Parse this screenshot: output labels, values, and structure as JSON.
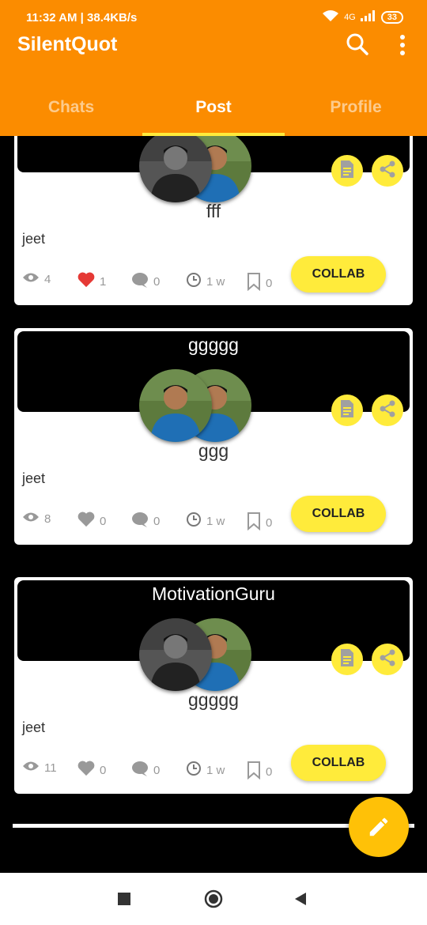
{
  "status_bar": {
    "time_speed": "11:32 AM | 38.4KB/s",
    "network": "4G",
    "battery": "33"
  },
  "app": {
    "title": "SilentQuot"
  },
  "tabs": [
    {
      "label": "Chats",
      "active": false
    },
    {
      "label": "Post",
      "active": true
    },
    {
      "label": "Profile",
      "active": false
    }
  ],
  "posts": [
    {
      "banner_title": "",
      "subtitle": "fff",
      "author": "jeet",
      "views": "4",
      "likes": "1",
      "liked": true,
      "comments": "0",
      "time": "1 w",
      "saves": "0",
      "collab_label": "COLLAB"
    },
    {
      "banner_title": "ggggg",
      "subtitle": "ggg",
      "author": "jeet",
      "views": "8",
      "likes": "0",
      "liked": false,
      "comments": "0",
      "time": "1 w",
      "saves": "0",
      "collab_label": "COLLAB"
    },
    {
      "banner_title": "MotivationGuru",
      "subtitle": "ggggg",
      "author": "jeet",
      "views": "11",
      "likes": "0",
      "liked": false,
      "comments": "0",
      "time": "1 w",
      "saves": "0",
      "collab_label": "COLLAB"
    }
  ],
  "colors": {
    "primary": "#FB8C00",
    "accent": "#FFEB3B",
    "fab": "#FFC107",
    "like": "#E53935"
  },
  "icons": [
    "search-icon",
    "more-vert-icon",
    "document-icon",
    "share-icon",
    "eye-icon",
    "heart-icon",
    "comment-icon",
    "clock-icon",
    "bookmark-icon",
    "edit-icon"
  ]
}
